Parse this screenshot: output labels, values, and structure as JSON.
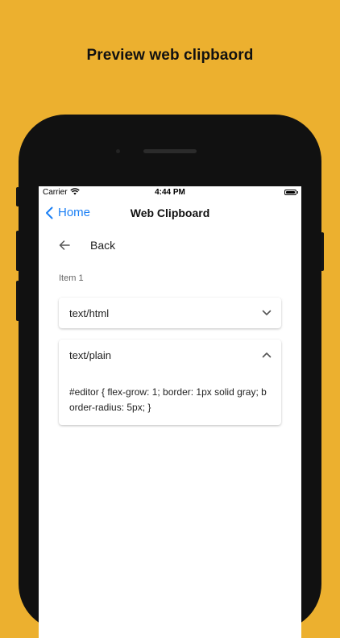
{
  "headline": "Preview web clipbaord",
  "status_bar": {
    "carrier": "Carrier",
    "time": "4:44 PM",
    "wifi_icon": "wifi-icon",
    "battery_icon": "battery-icon"
  },
  "nav": {
    "back_label": "Home",
    "title": "Web Clipboard",
    "accent_color": "#1a7ff5"
  },
  "content": {
    "back_label": "Back",
    "item_label": "Item 1",
    "entries": [
      {
        "type": "text/html",
        "expanded": false,
        "icon": "chevron-down-icon"
      },
      {
        "type": "text/plain",
        "expanded": true,
        "icon": "chevron-up-icon",
        "content": "#editor { flex-grow: 1; border: 1px solid gray; border-radius: 5px; }"
      }
    ]
  },
  "colors": {
    "background": "#ecb02f",
    "phone": "#111111",
    "screen": "#ffffff"
  }
}
